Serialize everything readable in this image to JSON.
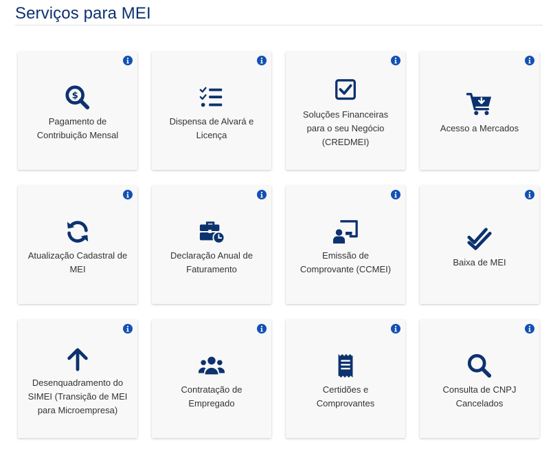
{
  "page": {
    "title": "Serviços para MEI"
  },
  "colors": {
    "primary": "#0c326f",
    "info": "#1351b4",
    "card_bg": "#f8f8f8"
  },
  "services": [
    {
      "label": "Pagamento de\nContribuição Mensal",
      "icon": "search-dollar-icon"
    },
    {
      "label": "Dispensa de Alvará e\nLicença",
      "icon": "checklist-icon"
    },
    {
      "label": "Soluções Financeiras\npara o seu Negócio\n(CREDMEI)",
      "icon": "check-square-icon"
    },
    {
      "label": "Acesso a Mercados",
      "icon": "cart-download-icon"
    },
    {
      "label": "Atualização Cadastral de\nMEI",
      "icon": "sync-icon"
    },
    {
      "label": "Declaração Anual de\nFaturamento",
      "icon": "business-time-icon"
    },
    {
      "label": "Emissão de\nComprovante (CCMEI)",
      "icon": "chalkboard-user-icon"
    },
    {
      "label": "Baixa de MEI",
      "icon": "double-check-icon"
    },
    {
      "label": "Desenquadramento do\nSIMEI (Transição de MEI\npara Microempresa)",
      "icon": "arrow-up-icon"
    },
    {
      "label": "Contratação de\nEmpregado",
      "icon": "users-icon"
    },
    {
      "label": "Certidões e\nComprovantes",
      "icon": "receipt-icon"
    },
    {
      "label": "Consulta de CNPJ\nCancelados",
      "icon": "search-icon"
    }
  ]
}
